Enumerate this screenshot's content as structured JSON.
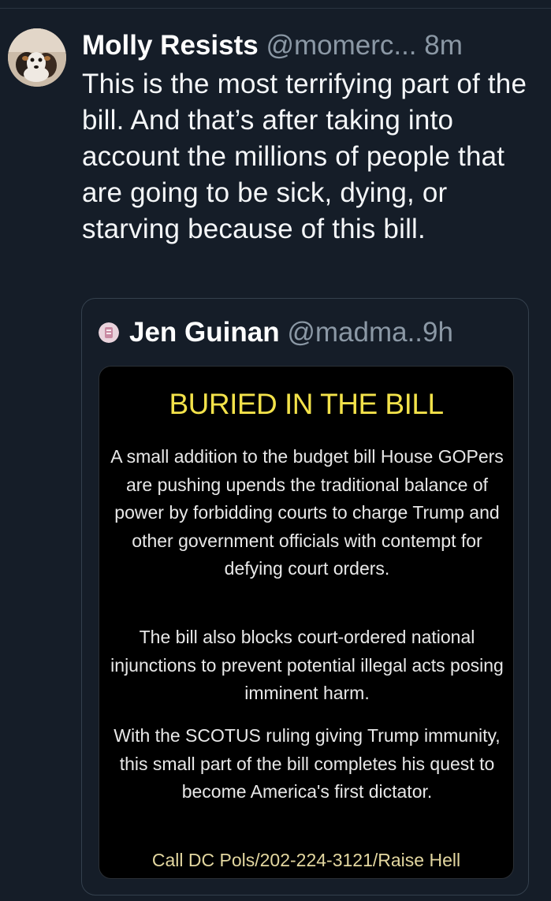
{
  "tweet": {
    "author_name": "Molly Resists",
    "author_handle": "@momerc...",
    "time": "8m",
    "text": "This is the most terrifying part of the bill. And that’s after taking into account the millions of people that are going to be sick, dying, or starving because of this bill."
  },
  "quote": {
    "author_name": "Jen Guinan",
    "author_handle": "@madma..",
    "time": "9h",
    "media": {
      "title": "BURIED IN THE BILL",
      "paragraph1": "A small addition to the budget bill House GOPers are pushing upends the traditional balance of power by forbidding courts to charge Trump and other government officials with contempt for defying court orders.",
      "paragraph2": "The bill also blocks court-ordered national injunctions to prevent potential illegal acts posing imminent harm.",
      "paragraph3": "With the SCOTUS ruling giving Trump immunity, this small part of the bill completes his quest to become America's first dictator.",
      "call_to_action": "Call DC Pols/202-224-3121/Raise Hell"
    }
  },
  "colors": {
    "background": "#151d28",
    "secondary_text": "#8b98a5",
    "headline_yellow": "#f3e24a"
  }
}
